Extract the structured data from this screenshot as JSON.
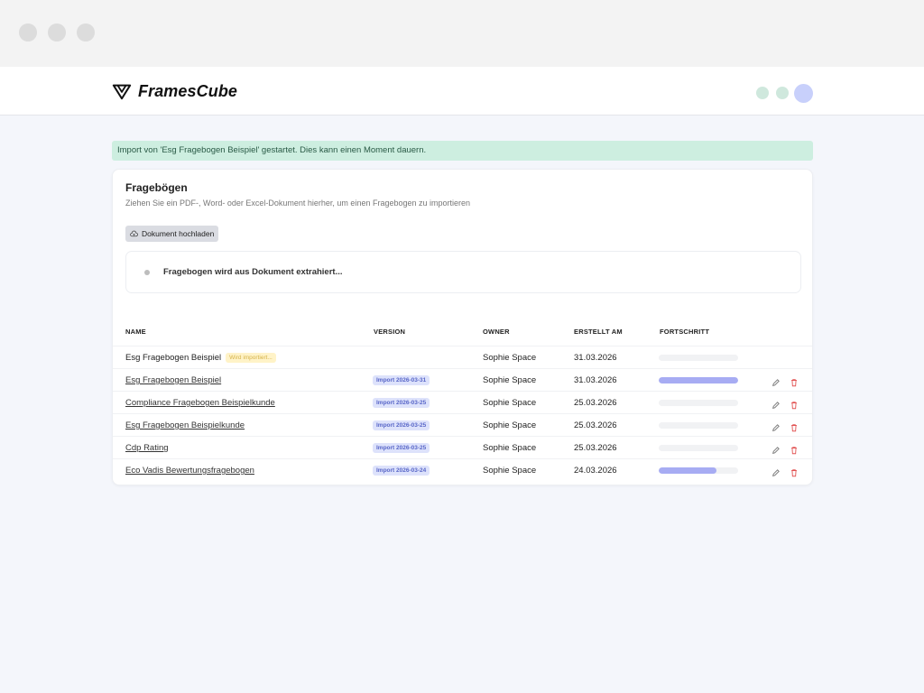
{
  "window": {
    "controls": [
      "close",
      "minimize",
      "maximize"
    ]
  },
  "header": {
    "brand": "FramesCube",
    "logo_icon": "framescube-logo-icon"
  },
  "notice": {
    "text": "Import von 'Esg Fragebogen Beispiel' gestartet. Dies kann einen Moment dauern.",
    "color": "#cdeee0"
  },
  "card": {
    "title": "Fragebögen",
    "subtitle": "Ziehen Sie ein PDF-, Word- oder Excel-Dokument hierher, um einen Fragebogen zu importieren",
    "upload_label": "Dokument hochladen",
    "extract_status": "Fragebogen wird aus Dokument extrahiert..."
  },
  "table": {
    "headers": {
      "name": "NAME",
      "version": "VERSION",
      "owner": "OWNER",
      "created": "ERSTELLT AM",
      "progress": "FORTSCHRITT"
    },
    "rows": [
      {
        "name": "Esg Fragebogen Beispiel",
        "status": "Wird importiert...",
        "version": "",
        "owner": "Sophie Space",
        "created": "31.03.2026",
        "progress": 0,
        "link": false,
        "actions": false
      },
      {
        "name": "Esg Fragebogen Beispiel",
        "status": "",
        "version": "Import 2026-03-31",
        "owner": "Sophie Space",
        "created": "31.03.2026",
        "progress": 1.0,
        "link": true,
        "actions": true
      },
      {
        "name": "Compliance Fragebogen Beispielkunde",
        "status": "",
        "version": "Import 2026-03-25",
        "owner": "Sophie Space",
        "created": "25.03.2026",
        "progress": 0,
        "link": true,
        "actions": true
      },
      {
        "name": "Esg Fragebogen Beispielkunde",
        "status": "",
        "version": "Import 2026-03-25",
        "owner": "Sophie Space",
        "created": "25.03.2026",
        "progress": 0,
        "link": true,
        "actions": true
      },
      {
        "name": "Cdp Rating",
        "status": "",
        "version": "Import 2026-03-25",
        "owner": "Sophie Space",
        "created": "25.03.2026",
        "progress": 0,
        "link": true,
        "actions": true
      },
      {
        "name": "Eco Vadis Bewertungsfragebogen",
        "status": "",
        "version": "Import 2026-03-24",
        "owner": "Sophie Space",
        "created": "24.03.2026",
        "progress": 0.73,
        "link": true,
        "actions": true
      }
    ]
  },
  "colors": {
    "accent": "#a7acf3",
    "badge": "#dde2fb",
    "delete": "#e25555"
  }
}
